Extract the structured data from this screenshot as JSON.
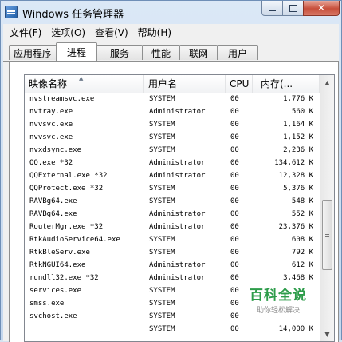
{
  "window": {
    "title": "Windows 任务管理器"
  },
  "menu": [
    "文件(F)",
    "选项(O)",
    "查看(V)",
    "帮助(H)"
  ],
  "tabs": [
    "应用程序",
    "进程",
    "服务",
    "性能",
    "联网",
    "用户"
  ],
  "active_tab": "进程",
  "columns": {
    "name": "映像名称",
    "user": "用户名",
    "cpu": "CPU",
    "mem": "内存(..."
  },
  "processes": [
    {
      "name": "nvstreamsvc.exe",
      "user": "SYSTEM",
      "cpu": "00",
      "mem": "1,776 K"
    },
    {
      "name": "nvtray.exe",
      "user": "Administrator",
      "cpu": "00",
      "mem": "560 K"
    },
    {
      "name": "nvvsvc.exe",
      "user": "SYSTEM",
      "cpu": "00",
      "mem": "1,164 K"
    },
    {
      "name": "nvvsvc.exe",
      "user": "SYSTEM",
      "cpu": "00",
      "mem": "1,152 K"
    },
    {
      "name": "nvxdsync.exe",
      "user": "SYSTEM",
      "cpu": "00",
      "mem": "2,236 K"
    },
    {
      "name": "QQ.exe *32",
      "user": "Administrator",
      "cpu": "00",
      "mem": "134,612 K"
    },
    {
      "name": "QQExternal.exe *32",
      "user": "Administrator",
      "cpu": "00",
      "mem": "12,328 K"
    },
    {
      "name": "QQProtect.exe *32",
      "user": "SYSTEM",
      "cpu": "00",
      "mem": "5,376 K"
    },
    {
      "name": "RAVBg64.exe",
      "user": "SYSTEM",
      "cpu": "00",
      "mem": "548 K"
    },
    {
      "name": "RAVBg64.exe",
      "user": "Administrator",
      "cpu": "00",
      "mem": "552 K"
    },
    {
      "name": "RouterMgr.exe *32",
      "user": "Administrator",
      "cpu": "00",
      "mem": "23,376 K"
    },
    {
      "name": "RtkAudioService64.exe",
      "user": "SYSTEM",
      "cpu": "00",
      "mem": "608 K"
    },
    {
      "name": "RtkBleServ.exe",
      "user": "SYSTEM",
      "cpu": "00",
      "mem": "792 K"
    },
    {
      "name": "RtkNGUI64.exe",
      "user": "Administrator",
      "cpu": "00",
      "mem": "612 K"
    },
    {
      "name": "rundll32.exe *32",
      "user": "Administrator",
      "cpu": "00",
      "mem": "3,468 K"
    },
    {
      "name": "services.exe",
      "user": "SYSTEM",
      "cpu": "00",
      "mem": ""
    },
    {
      "name": "smss.exe",
      "user": "SYSTEM",
      "cpu": "00",
      "mem": ""
    },
    {
      "name": "svchost.exe",
      "user": "SYSTEM",
      "cpu": "00",
      "mem": ""
    },
    {
      "name": "",
      "user": "SYSTEM",
      "cpu": "00",
      "mem": "14,000 K"
    }
  ],
  "watermark": {
    "title": "百科全说",
    "subtitle": "助你轻松解决"
  },
  "icons": {
    "minimize": "minimize-icon",
    "maximize": "maximize-icon",
    "close": "close-icon",
    "sort": "sort-up-icon",
    "scroll_up": "scroll-up-icon",
    "scroll_down": "scroll-down-icon"
  },
  "colors": {
    "title_bar": "#c4d7ee",
    "close_button": "#c74e3a",
    "watermark": "#2d9c4a"
  }
}
